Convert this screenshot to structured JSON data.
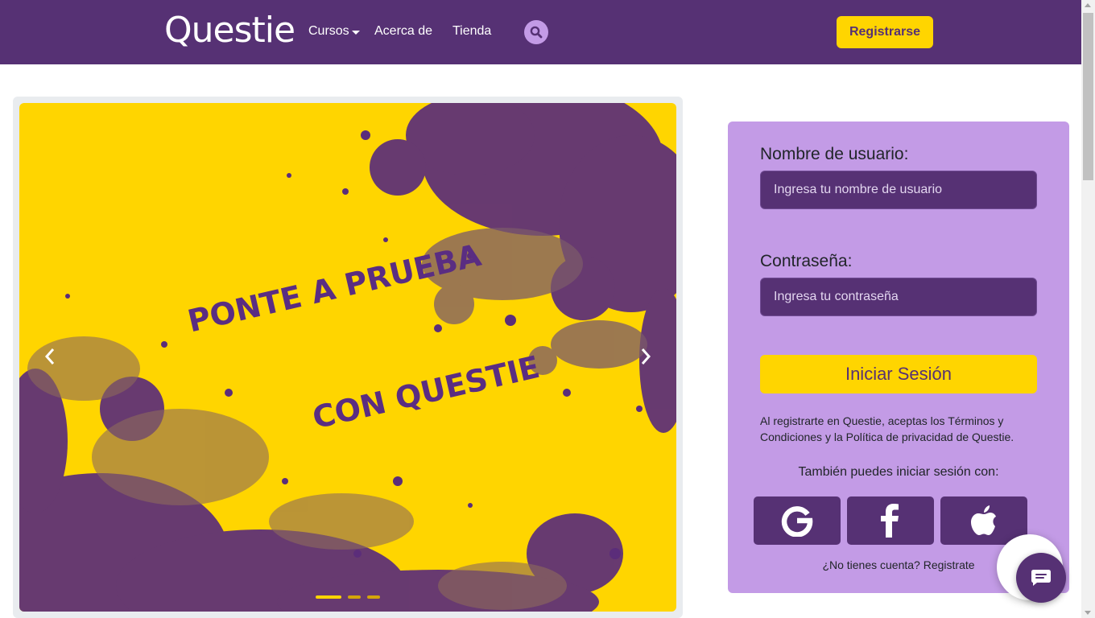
{
  "nav": {
    "brand": "Questie",
    "links": {
      "cursos": "Cursos",
      "acerca": "Acerca de",
      "tienda": "Tienda"
    },
    "register_label": "Registrarse"
  },
  "carousel": {
    "line1": "PONTE A PRUEBA",
    "line2": "CON QUESTIE",
    "slide_count": 3,
    "active_slide": 1
  },
  "login": {
    "username_label": "Nombre de usuario:",
    "username_placeholder": "Ingresa tu nombre de usuario",
    "password_label": "Contraseña:",
    "password_placeholder": "Ingresa tu contraseña",
    "submit_label": "Iniciar Sesión",
    "terms_text": "Al registrarte en Questie, aceptas los Términos y Condiciones y la Política de privacidad de Questie.",
    "alt_login_text": "También puedes iniciar sesión con:",
    "social": [
      "google-icon",
      "facebook-icon",
      "apple-icon"
    ],
    "signup_text": "¿No tienes cuenta? Registrate"
  },
  "colors": {
    "primary_purple": "#563174",
    "accent_yellow": "#ffd500",
    "panel_lavender": "#c39be6"
  }
}
